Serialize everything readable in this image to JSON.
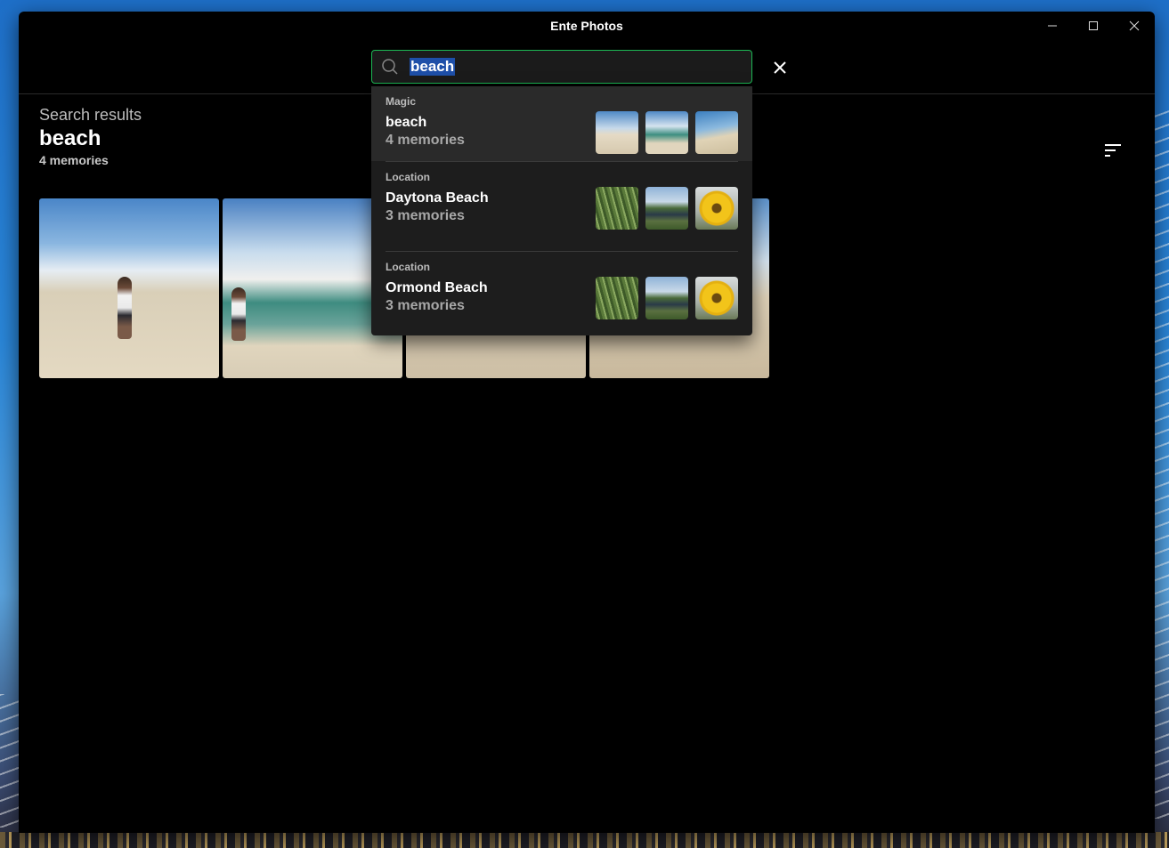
{
  "window": {
    "title": "Ente Photos"
  },
  "search": {
    "query": "beach"
  },
  "results": {
    "caption": "Search results",
    "query": "beach",
    "count": "4 memories"
  },
  "suggestions": [
    {
      "type": "Magic",
      "name": "beach",
      "count": "4 memories",
      "thumbs": [
        "beach-photo",
        "lagoon-photo",
        "shore-photo"
      ]
    },
    {
      "type": "Location",
      "name": "Daytona Beach",
      "count": "3 memories",
      "thumbs": [
        "grass-photo",
        "river-photo",
        "sunflower-photo"
      ]
    },
    {
      "type": "Location",
      "name": "Ormond Beach",
      "count": "3 memories",
      "thumbs": [
        "grass-photo",
        "river-photo",
        "sunflower-photo"
      ]
    }
  ],
  "colors": {
    "accent": "#1db954",
    "selection": "#1e4fa8",
    "background": "#000000"
  },
  "icons": [
    "search-icon",
    "close-icon",
    "sort-icon",
    "minimize-icon",
    "maximize-icon",
    "window-close-icon"
  ]
}
